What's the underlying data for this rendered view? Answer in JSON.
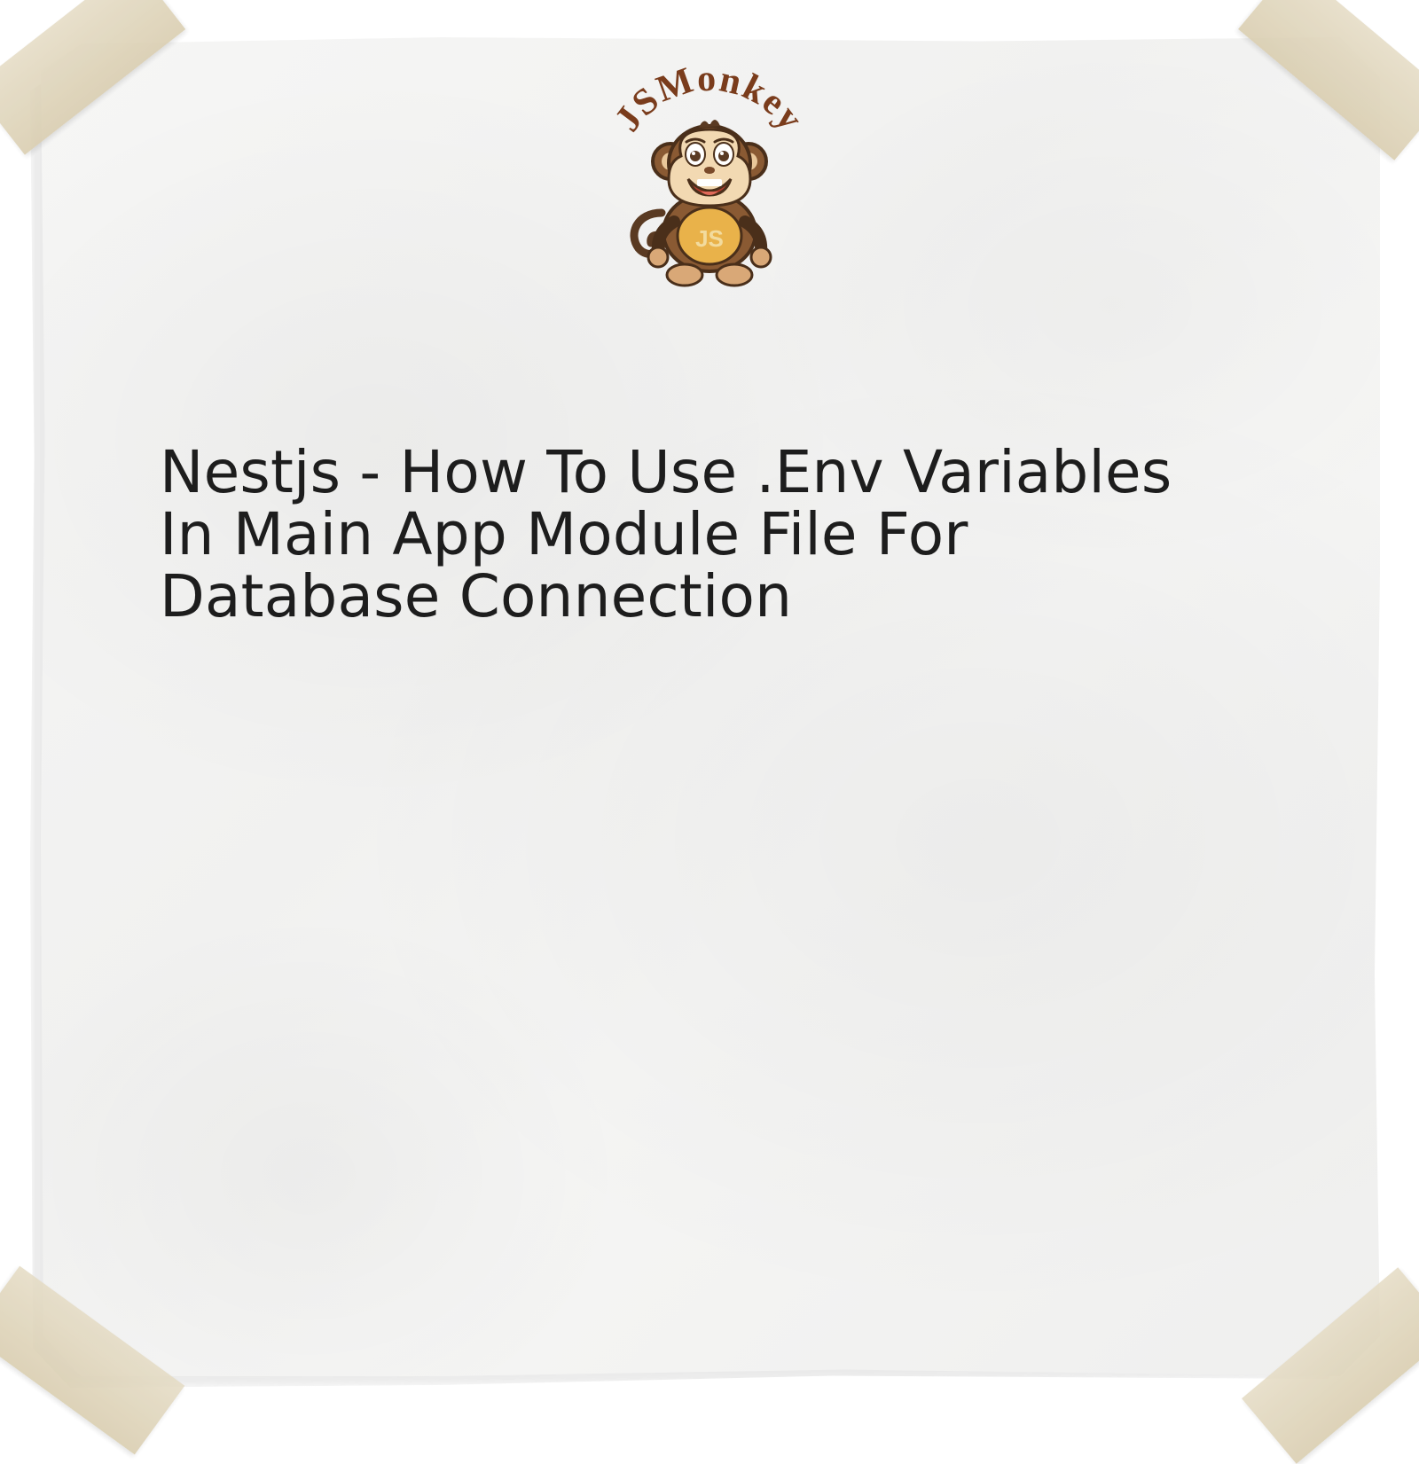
{
  "logo": {
    "brand_text": "JSMonkey",
    "shield_text": "JS"
  },
  "title": "Nestjs - How To Use .Env Variables In Main App Module File For Database Connection",
  "colors": {
    "paper": "#f3f3f2",
    "tape": "#ddd3b8",
    "text": "#1d1d1d",
    "brand_brown_dark": "#7a3c1c",
    "brand_brown": "#a15a2a",
    "brand_tan": "#c98c4f",
    "brand_cream": "#f2d9b2",
    "brand_yellow": "#e9b24a",
    "brand_red": "#b13b2c"
  }
}
